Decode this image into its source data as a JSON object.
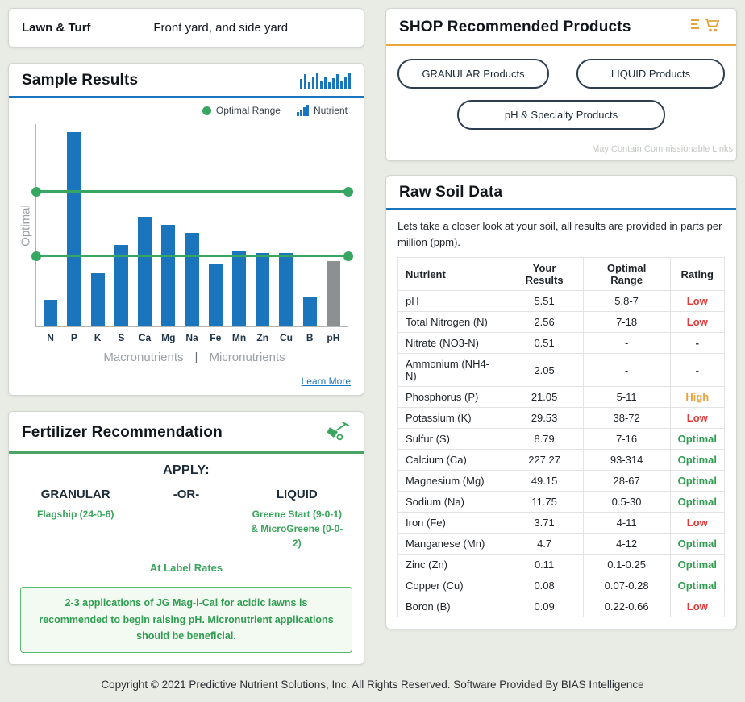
{
  "sample_info": {
    "category": "Lawn & Turf",
    "sample_name": "Front yard, and side yard"
  },
  "sample_results": {
    "title": "Sample Results",
    "legend_optimal": "Optimal Range",
    "legend_nutrient": "Nutrient",
    "ylabel": "Optimal",
    "macro_label": "Macronutrients",
    "separator": "|",
    "micro_label": "Micronutrients",
    "learn_more": "Learn More"
  },
  "chart_data": {
    "type": "bar",
    "title": "Sample Results",
    "categories": [
      "N",
      "P",
      "K",
      "S",
      "Ca",
      "Mg",
      "Na",
      "Fe",
      "Mn",
      "Zn",
      "Cu",
      "B",
      "pH"
    ],
    "values_percent_of_plot": [
      13,
      96,
      26,
      40,
      54,
      50,
      46,
      31,
      37,
      36,
      36,
      14,
      32
    ],
    "units": "percent of plot height (normalized vs optimal band)",
    "optimal_band_percent": [
      34,
      66
    ],
    "bar_color": "#1b75bc",
    "ph_bar_color": "#8d9093",
    "line_color": "#37a662",
    "ylabel": "Optimal",
    "x_group_labels": [
      "Macronutrients",
      "Micronutrients"
    ],
    "legend": [
      "Optimal Range",
      "Nutrient"
    ]
  },
  "fertilizer": {
    "title": "Fertilizer Recommendation",
    "apply_label": "APPLY:",
    "granular_label": "GRANULAR",
    "or_label": "-OR-",
    "liquid_label": "LIQUID",
    "granular_product": "Flagship (24-0-6)",
    "liquid_product": "Greene Start (9-0-1) & MicroGreene (0-0-2)",
    "rates_label": "At Label Rates",
    "note": "2-3 applications of JG Mag-i-Cal for acidic lawns is recommended to begin raising pH. Micronutrient applications should be beneficial."
  },
  "shop": {
    "title": "SHOP Recommended Products",
    "buttons": [
      "GRANULAR Products",
      "LIQUID Products",
      "pH & Specialty Products"
    ],
    "disclaimer": "May Contain Commissionable Links"
  },
  "raw_soil": {
    "title": "Raw Soil Data",
    "description": "Lets take a closer look at your soil, all results are provided in parts per million (ppm).",
    "columns": [
      "Nutrient",
      "Your Results",
      "Optimal Range",
      "Rating"
    ],
    "rows": [
      {
        "nutrient": "pH",
        "result": "5.51",
        "range": "5.8-7",
        "rating": "Low"
      },
      {
        "nutrient": "Total Nitrogen (N)",
        "result": "2.56",
        "range": "7-18",
        "rating": "Low"
      },
      {
        "nutrient": "Nitrate (NO3-N)",
        "result": "0.51",
        "range": "-",
        "rating": "-"
      },
      {
        "nutrient": "Ammonium (NH4-N)",
        "result": "2.05",
        "range": "-",
        "rating": "-"
      },
      {
        "nutrient": "Phosphorus (P)",
        "result": "21.05",
        "range": "5-11",
        "rating": "High"
      },
      {
        "nutrient": "Potassium (K)",
        "result": "29.53",
        "range": "38-72",
        "rating": "Low"
      },
      {
        "nutrient": "Sulfur (S)",
        "result": "8.79",
        "range": "7-16",
        "rating": "Optimal"
      },
      {
        "nutrient": "Calcium (Ca)",
        "result": "227.27",
        "range": "93-314",
        "rating": "Optimal"
      },
      {
        "nutrient": "Magnesium (Mg)",
        "result": "49.15",
        "range": "28-67",
        "rating": "Optimal"
      },
      {
        "nutrient": "Sodium (Na)",
        "result": "11.75",
        "range": "0.5-30",
        "rating": "Optimal"
      },
      {
        "nutrient": "Iron (Fe)",
        "result": "3.71",
        "range": "4-11",
        "rating": "Low"
      },
      {
        "nutrient": "Manganese (Mn)",
        "result": "4.7",
        "range": "4-12",
        "rating": "Optimal"
      },
      {
        "nutrient": "Zinc (Zn)",
        "result": "0.11",
        "range": "0.1-0.25",
        "rating": "Optimal"
      },
      {
        "nutrient": "Copper (Cu)",
        "result": "0.08",
        "range": "0.07-0.28",
        "rating": "Optimal"
      },
      {
        "nutrient": "Boron (B)",
        "result": "0.09",
        "range": "0.22-0.66",
        "rating": "Low"
      }
    ],
    "rating_colors": {
      "Low": "#e03c3c",
      "High": "#e8a33d",
      "Optimal": "#2f9e50",
      "-": "#333333"
    }
  },
  "footer": {
    "text": "Copyright © 2021 Predictive Nutrient Solutions, Inc. All Rights Reserved. Software Provided By BIAS Intelligence"
  }
}
